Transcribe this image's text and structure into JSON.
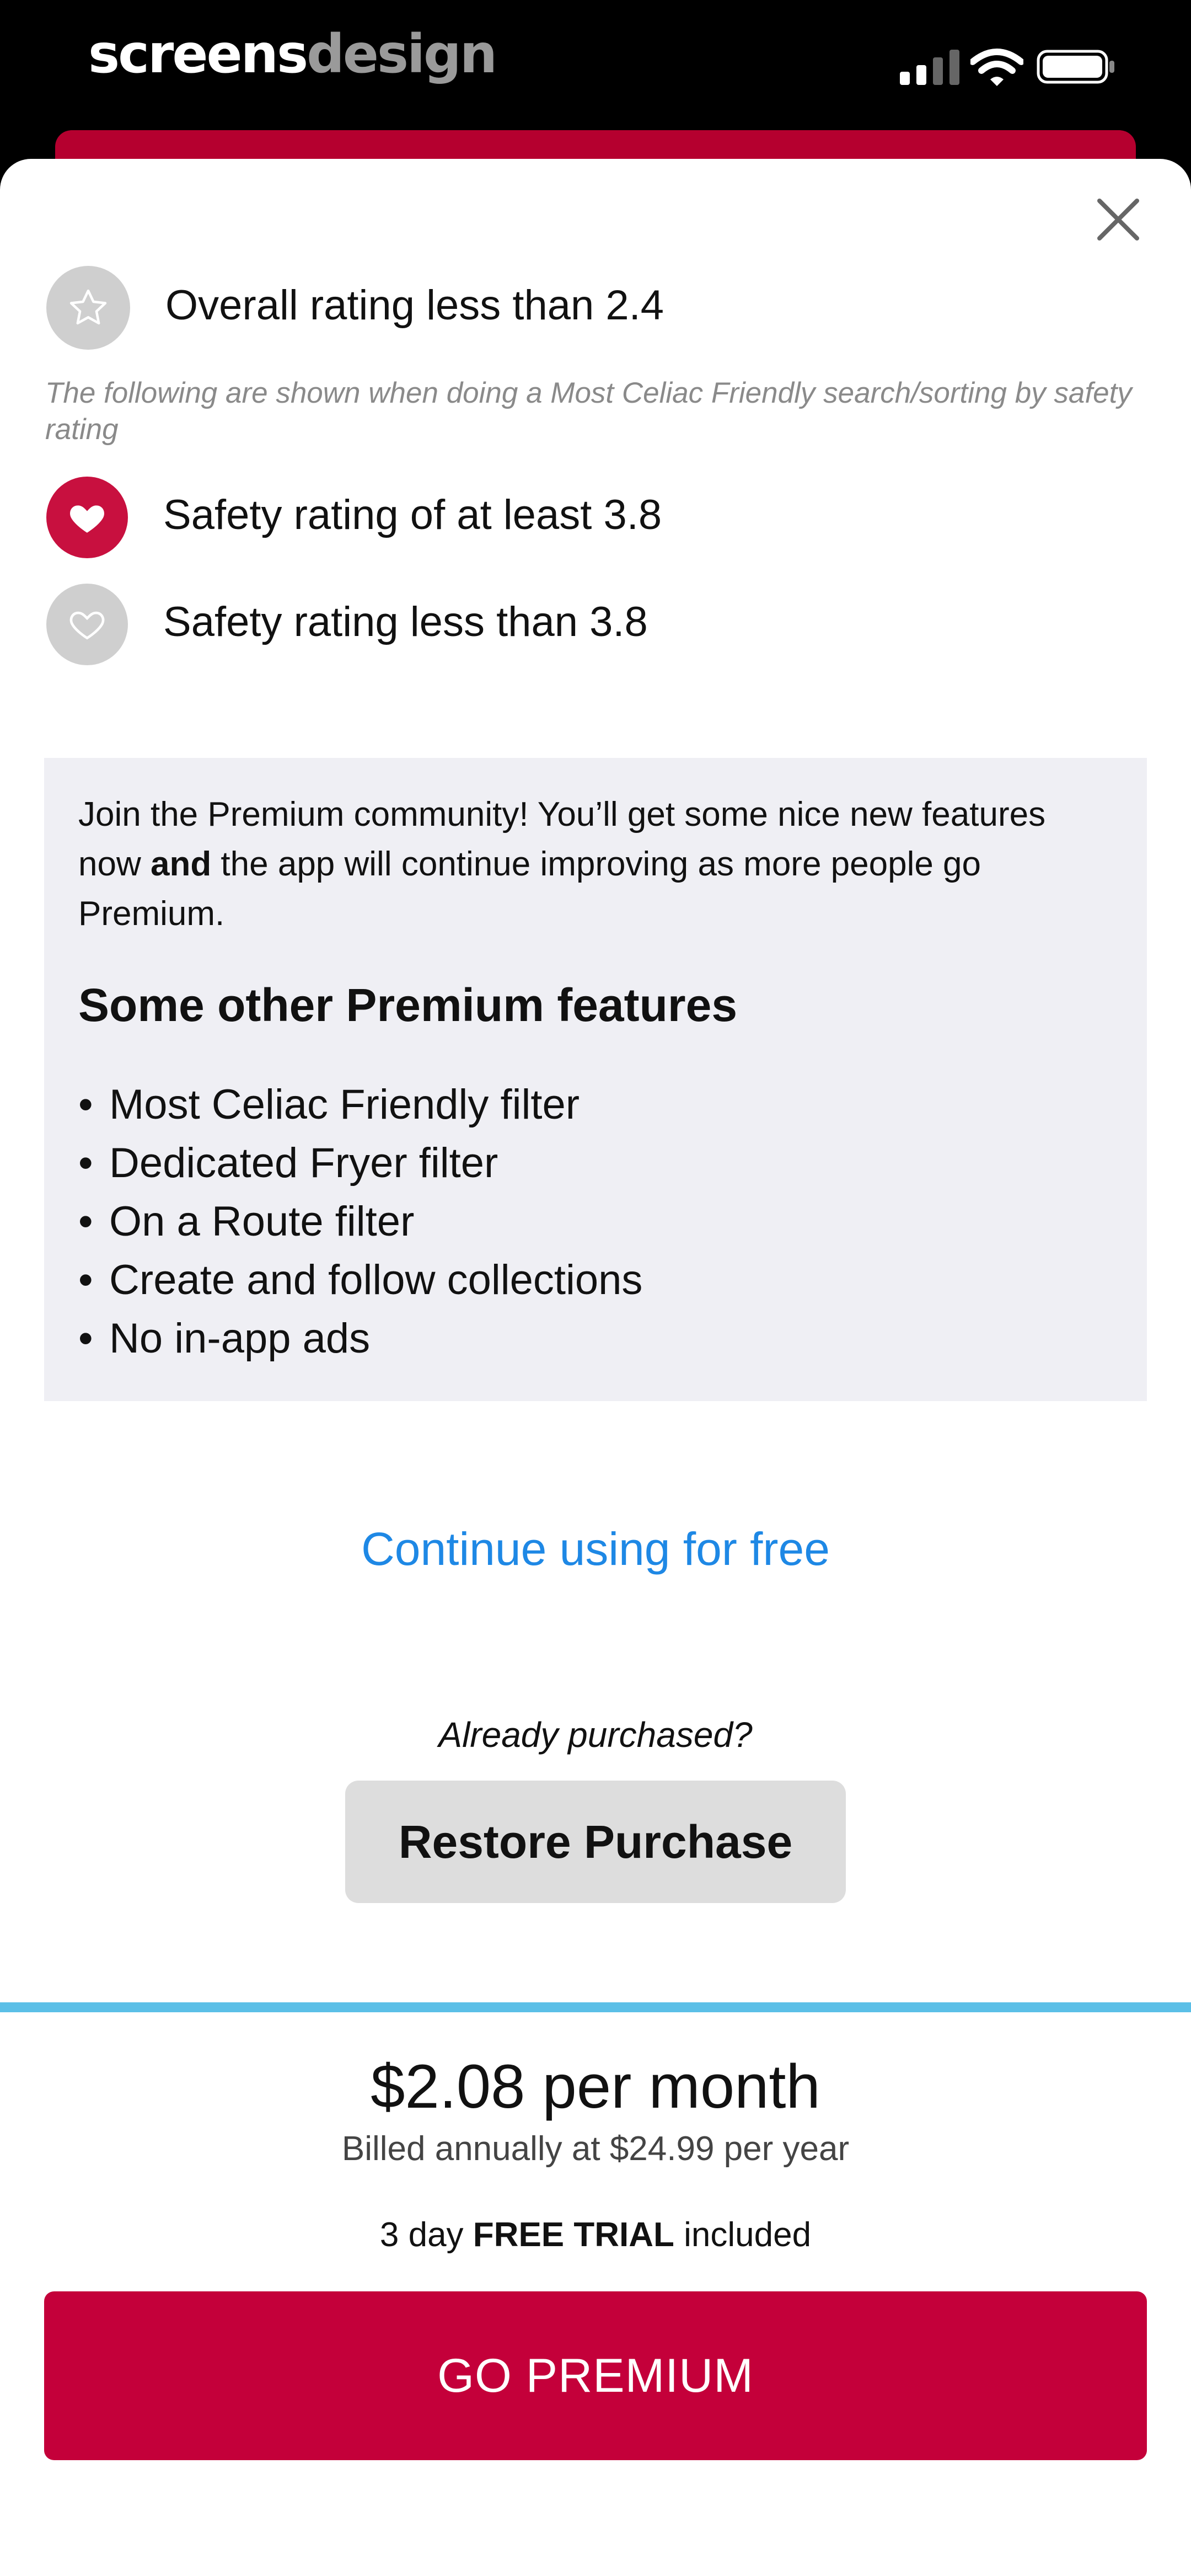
{
  "status_bar": {
    "brand_part1": "screens",
    "brand_part2": "design"
  },
  "legend": {
    "overall_low": "Overall rating less than 2.4",
    "note": "The following are shown when doing a Most Celiac Friendly search/sorting by safety rating",
    "safety_high": "Safety rating of at least 3.8",
    "safety_low": "Safety rating less than 3.8"
  },
  "premium": {
    "intro_part1": "Join the Premium community! You’ll get some nice new features now ",
    "intro_bold": "and",
    "intro_part2": " the app will continue improving as more people go Premium.",
    "features_title": "Some other Premium features",
    "features": [
      "Most Celiac Friendly filter",
      "Dedicated Fryer filter",
      "On a Route filter",
      "Create and follow collections",
      "No in-app ads"
    ]
  },
  "actions": {
    "continue_free": "Continue using for free",
    "already_purchased": "Already purchased?",
    "restore_purchase": "Restore Purchase"
  },
  "pricing": {
    "price": "$2.08 per month",
    "billed": "Billed annually at $24.99 per year",
    "trial_prefix": "3 day ",
    "trial_bold": "FREE TRIAL",
    "trial_suffix": " included",
    "go_premium": "GO PREMIUM"
  },
  "colors": {
    "brand_red": "#c4003a",
    "link_blue": "#1e88e5",
    "divider_blue": "#5bbfe7"
  }
}
